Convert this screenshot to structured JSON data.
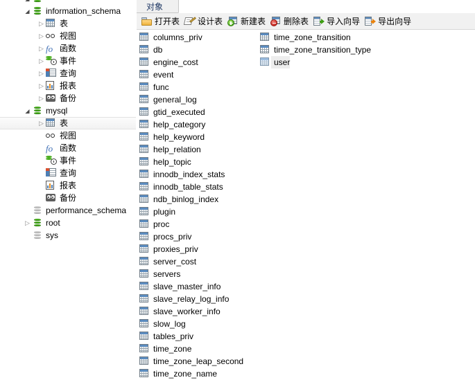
{
  "app": {
    "kind": "database-client",
    "accent_green": "#4caf22",
    "accent_blue": "#5b8cc0",
    "selection_bg": "#ededed"
  },
  "sidebar": {
    "items": [
      {
        "label": "",
        "icon": "database-icon",
        "level": 1,
        "arrow": "open",
        "state": "connected",
        "selected": false,
        "clipped": true
      },
      {
        "label": "information_schema",
        "icon": "database-icon",
        "level": 1,
        "arrow": "open",
        "state": "connected",
        "selected": false
      },
      {
        "label": "表",
        "icon": "table-icon",
        "level": 2,
        "arrow": "closed",
        "state": "",
        "selected": false
      },
      {
        "label": "视图",
        "icon": "view-icon",
        "level": 2,
        "arrow": "closed",
        "state": "",
        "selected": false
      },
      {
        "label": "函数",
        "icon": "function-icon",
        "level": 2,
        "arrow": "closed",
        "state": "",
        "selected": false
      },
      {
        "label": "事件",
        "icon": "event-clock-icon",
        "level": 2,
        "arrow": "closed",
        "state": "",
        "selected": false
      },
      {
        "label": "查询",
        "icon": "query-icon",
        "level": 2,
        "arrow": "closed",
        "state": "",
        "selected": false
      },
      {
        "label": "报表",
        "icon": "report-icon",
        "level": 2,
        "arrow": "closed",
        "state": "",
        "selected": false
      },
      {
        "label": "备份",
        "icon": "backup-icon",
        "level": 2,
        "arrow": "closed",
        "state": "",
        "selected": false
      },
      {
        "label": "mysql",
        "icon": "database-icon",
        "level": 1,
        "arrow": "open",
        "state": "connected",
        "selected": false
      },
      {
        "label": "表",
        "icon": "table-icon",
        "level": 2,
        "arrow": "closed",
        "state": "",
        "selected": true
      },
      {
        "label": "视图",
        "icon": "view-icon",
        "level": 2,
        "arrow": "none",
        "state": "",
        "selected": false
      },
      {
        "label": "函数",
        "icon": "function-icon",
        "level": 2,
        "arrow": "none",
        "state": "",
        "selected": false
      },
      {
        "label": "事件",
        "icon": "event-clock-icon",
        "level": 2,
        "arrow": "none",
        "state": "",
        "selected": false
      },
      {
        "label": "查询",
        "icon": "query-icon",
        "level": 2,
        "arrow": "none",
        "state": "",
        "selected": false
      },
      {
        "label": "报表",
        "icon": "report-icon",
        "level": 2,
        "arrow": "none",
        "state": "",
        "selected": false
      },
      {
        "label": "备份",
        "icon": "backup-icon",
        "level": 2,
        "arrow": "none",
        "state": "",
        "selected": false
      },
      {
        "label": "performance_schema",
        "icon": "database-icon",
        "level": 1,
        "arrow": "none",
        "state": "disconnected",
        "selected": false
      },
      {
        "label": "root",
        "icon": "database-icon",
        "level": 1,
        "arrow": "closed",
        "state": "connected",
        "selected": false
      },
      {
        "label": "sys",
        "icon": "database-icon",
        "level": 1,
        "arrow": "none",
        "state": "disconnected",
        "selected": false
      }
    ]
  },
  "right_panel": {
    "tab": {
      "label": "对象"
    },
    "toolbar": {
      "buttons": [
        {
          "label": "打开表",
          "icon": "open-table-folder-icon"
        },
        {
          "label": "设计表",
          "icon": "design-table-pencil-icon"
        },
        {
          "label": "新建表",
          "icon": "new-table-plus-icon"
        },
        {
          "label": "删除表",
          "icon": "delete-table-minus-icon"
        },
        {
          "label": "导入向导",
          "icon": "import-wizard-icon"
        },
        {
          "label": "导出向导",
          "icon": "export-wizard-icon"
        }
      ]
    },
    "table_list": {
      "column1": [
        {
          "name": "columns_priv",
          "icon": "table-icon",
          "selected": false
        },
        {
          "name": "db",
          "icon": "table-icon",
          "selected": false
        },
        {
          "name": "engine_cost",
          "icon": "table-icon",
          "selected": false
        },
        {
          "name": "event",
          "icon": "table-icon",
          "selected": false
        },
        {
          "name": "func",
          "icon": "table-icon",
          "selected": false
        },
        {
          "name": "general_log",
          "icon": "table-icon",
          "selected": false
        },
        {
          "name": "gtid_executed",
          "icon": "table-icon",
          "selected": false
        },
        {
          "name": "help_category",
          "icon": "table-icon",
          "selected": false
        },
        {
          "name": "help_keyword",
          "icon": "table-icon",
          "selected": false
        },
        {
          "name": "help_relation",
          "icon": "table-icon",
          "selected": false
        },
        {
          "name": "help_topic",
          "icon": "table-icon",
          "selected": false
        },
        {
          "name": "innodb_index_stats",
          "icon": "table-icon",
          "selected": false
        },
        {
          "name": "innodb_table_stats",
          "icon": "table-icon",
          "selected": false
        },
        {
          "name": "ndb_binlog_index",
          "icon": "table-icon",
          "selected": false
        },
        {
          "name": "plugin",
          "icon": "table-icon",
          "selected": false
        },
        {
          "name": "proc",
          "icon": "table-icon",
          "selected": false
        },
        {
          "name": "procs_priv",
          "icon": "table-icon",
          "selected": false
        },
        {
          "name": "proxies_priv",
          "icon": "table-icon",
          "selected": false
        },
        {
          "name": "server_cost",
          "icon": "table-icon",
          "selected": false
        },
        {
          "name": "servers",
          "icon": "table-icon",
          "selected": false
        },
        {
          "name": "slave_master_info",
          "icon": "table-icon",
          "selected": false
        },
        {
          "name": "slave_relay_log_info",
          "icon": "table-icon",
          "selected": false
        },
        {
          "name": "slave_worker_info",
          "icon": "table-icon",
          "selected": false
        },
        {
          "name": "slow_log",
          "icon": "table-icon",
          "selected": false
        },
        {
          "name": "tables_priv",
          "icon": "table-icon",
          "selected": false
        },
        {
          "name": "time_zone",
          "icon": "table-icon",
          "selected": false
        },
        {
          "name": "time_zone_leap_second",
          "icon": "table-icon",
          "selected": false
        },
        {
          "name": "time_zone_name",
          "icon": "table-icon",
          "selected": false
        }
      ],
      "column2": [
        {
          "name": "time_zone_transition",
          "icon": "table-icon",
          "selected": false
        },
        {
          "name": "time_zone_transition_type",
          "icon": "table-icon",
          "selected": false
        },
        {
          "name": "user",
          "icon": "table-icon",
          "selected": true
        }
      ]
    }
  }
}
